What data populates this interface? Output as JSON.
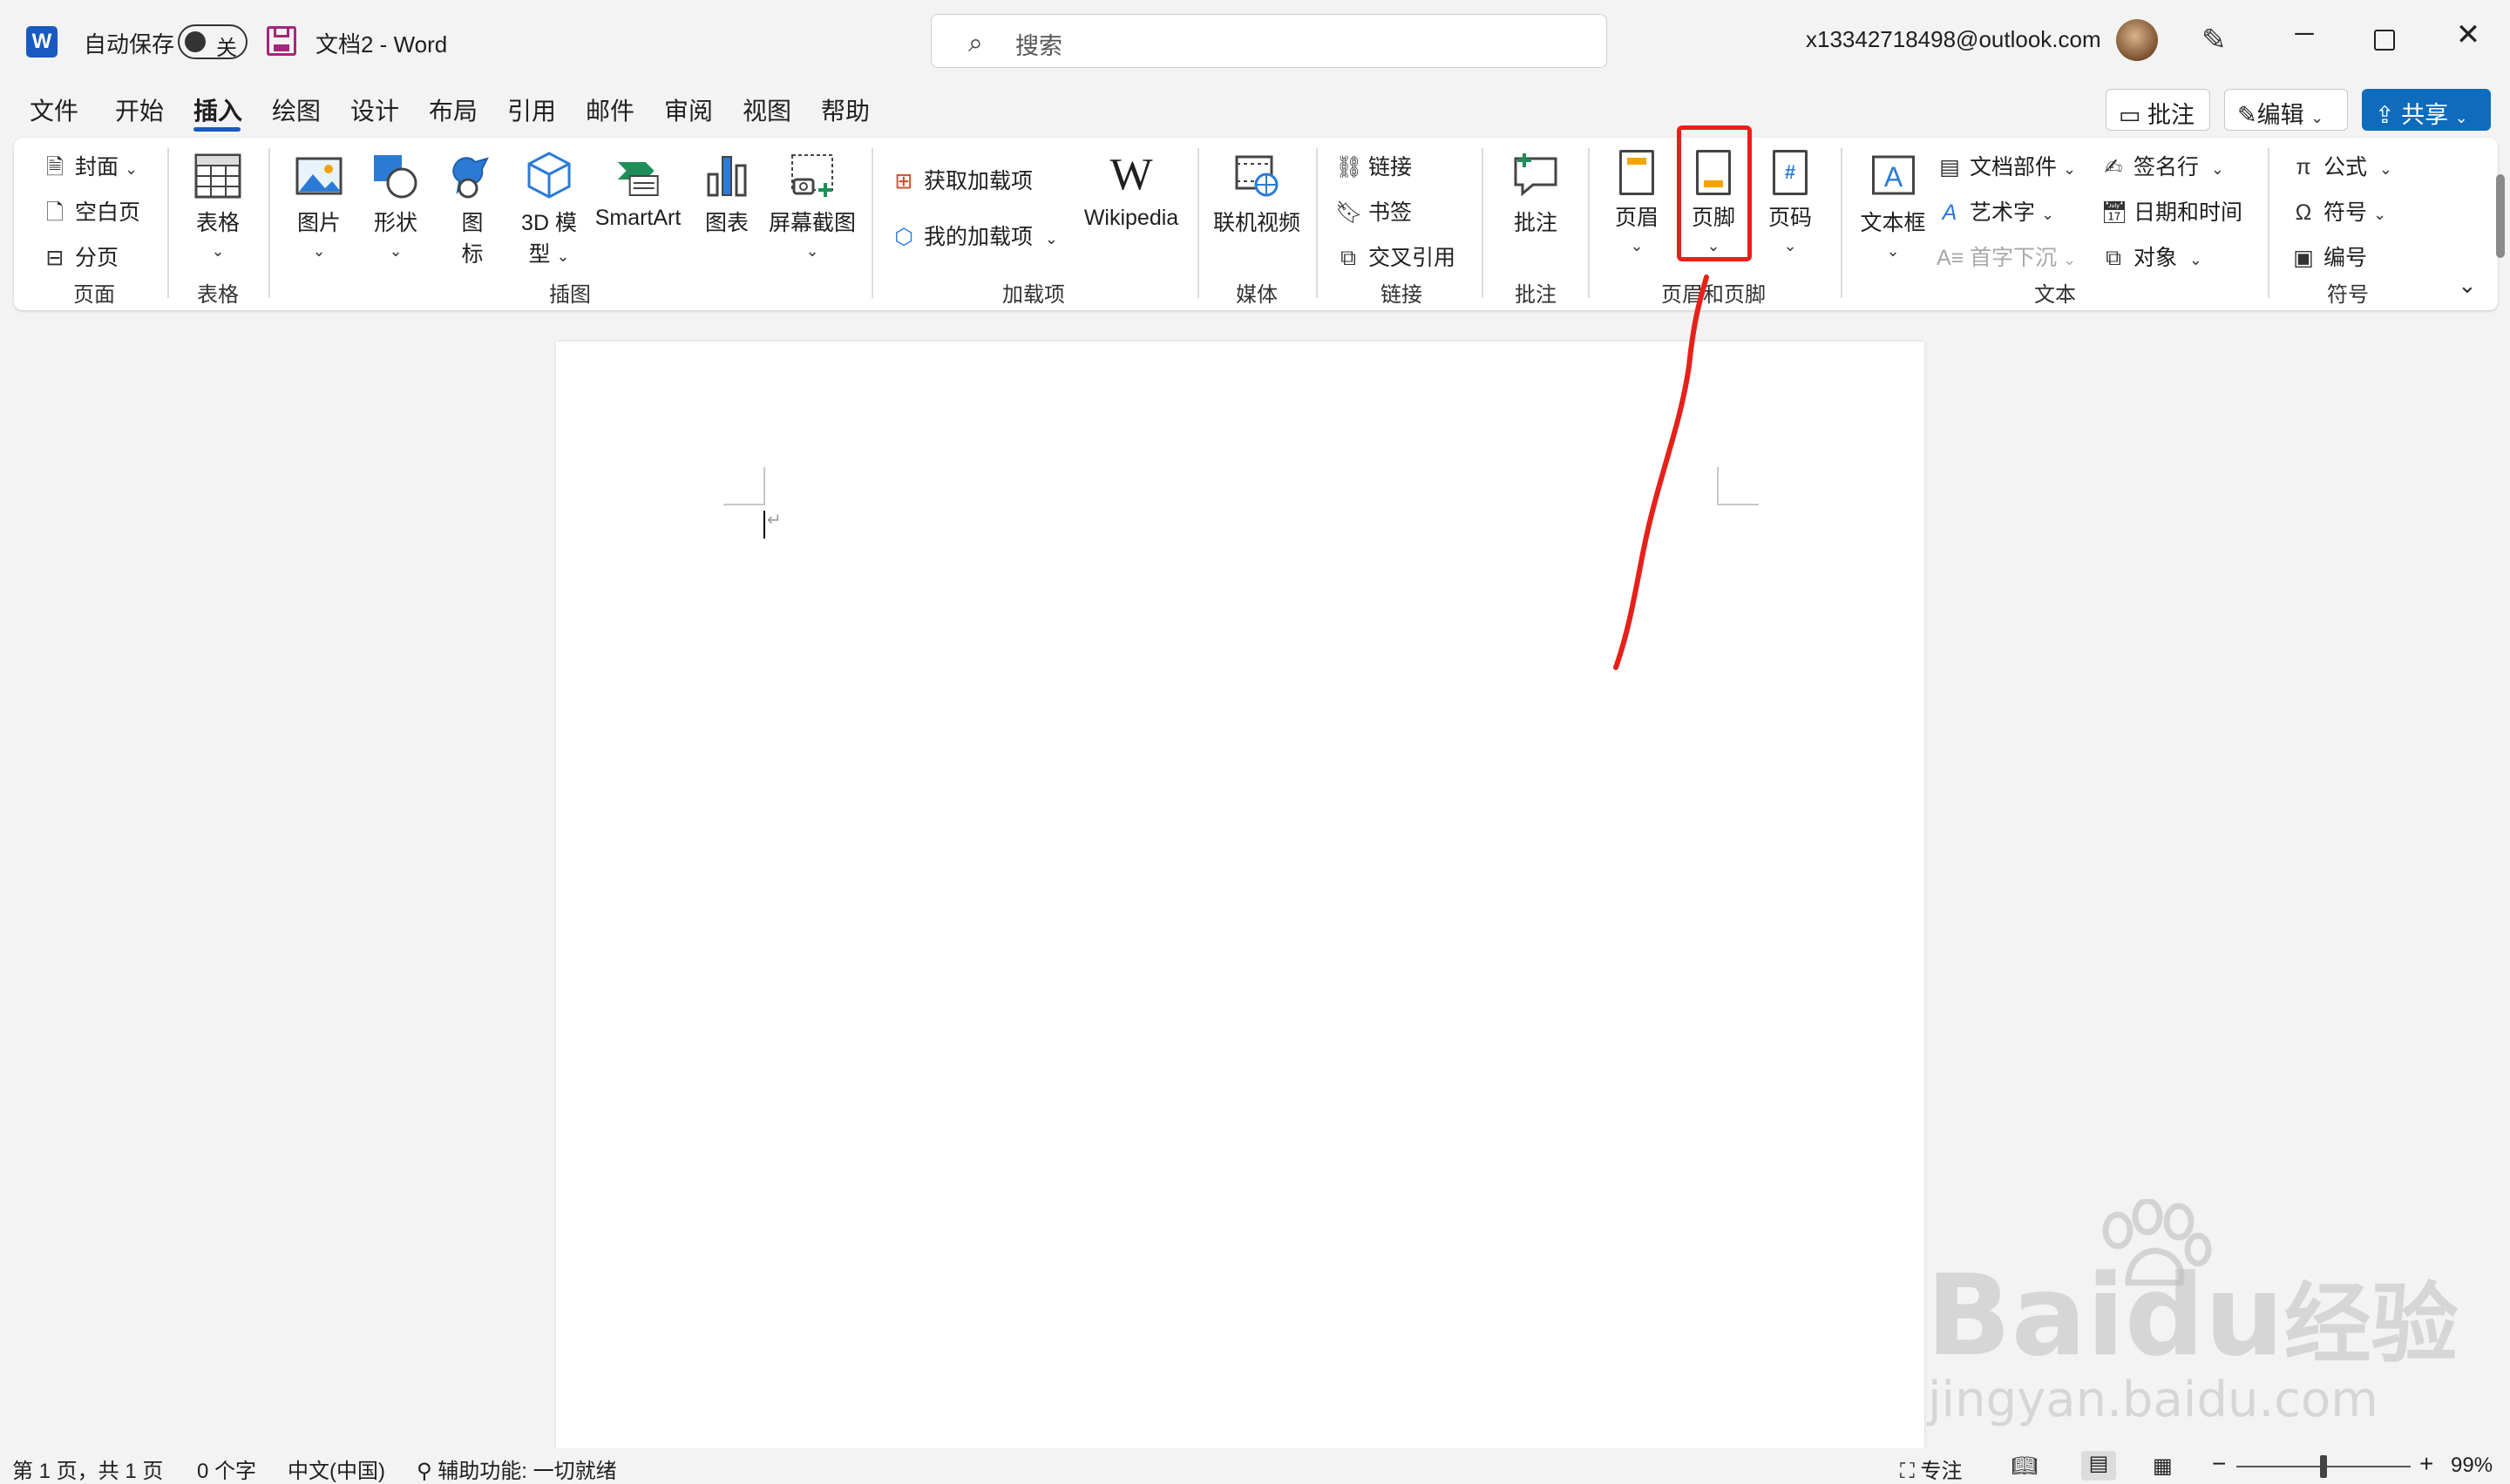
{
  "titlebar": {
    "autosave_label": "自动保存",
    "autosave_state": "关",
    "doc_title": "文档2 - Word",
    "search_placeholder": "搜索",
    "account": "x13342718498@outlook.com"
  },
  "menu": {
    "tabs": [
      "文件",
      "开始",
      "插入",
      "绘图",
      "设计",
      "布局",
      "引用",
      "邮件",
      "审阅",
      "视图",
      "帮助"
    ],
    "active_tab": "插入",
    "comment_btn": "批注",
    "edit_btn": "编辑",
    "share_btn": "共享"
  },
  "ribbon": {
    "pages": {
      "label": "页面",
      "cover": "封面",
      "blank": "空白页",
      "break": "分页"
    },
    "tables": {
      "label": "表格",
      "table": "表格"
    },
    "illustrations": {
      "label": "插图",
      "picture": "图片",
      "shapes": "形状",
      "icons_l1": "图",
      "icons_l2": "标",
      "model_l1": "3D 模",
      "model_l2": "型",
      "smartart": "SmartArt",
      "chart": "图表",
      "screenshot": "屏幕截图"
    },
    "addins": {
      "label": "加载项",
      "get": "获取加载项",
      "mine": "我的加载项",
      "wikipedia": "Wikipedia"
    },
    "media": {
      "label": "媒体",
      "video": "联机视频"
    },
    "links": {
      "label": "链接",
      "link": "链接",
      "bookmark": "书签",
      "crossref": "交叉引用"
    },
    "comments": {
      "label": "批注",
      "comment": "批注"
    },
    "headerfooter": {
      "label": "页眉和页脚",
      "header": "页眉",
      "footer": "页脚",
      "pagenum": "页码"
    },
    "text": {
      "label": "文本",
      "textbox": "文本框",
      "parts": "文档部件",
      "wordart": "艺术字",
      "dropcap": "首字下沉",
      "signature": "签名行",
      "datetime": "日期和时间",
      "object": "对象"
    },
    "symbols": {
      "label": "符号",
      "equation": "公式",
      "symbol": "符号",
      "number": "编号"
    }
  },
  "statusbar": {
    "page": "第 1 页，共 1 页",
    "words": "0 个字",
    "lang": "中文(中国)",
    "accessibility": "辅助功能: 一切就绪",
    "focus": "专注",
    "zoom": "99%"
  },
  "watermark": {
    "brand": "Bai",
    "brand_suffix": "du",
    "brand_cn": "经验",
    "url": "jingyan.baidu.com"
  },
  "colors": {
    "accent": "#185abd",
    "share": "#0f6cbd",
    "highlight": "#e8201a"
  },
  "zoom_fraction": 0.5
}
